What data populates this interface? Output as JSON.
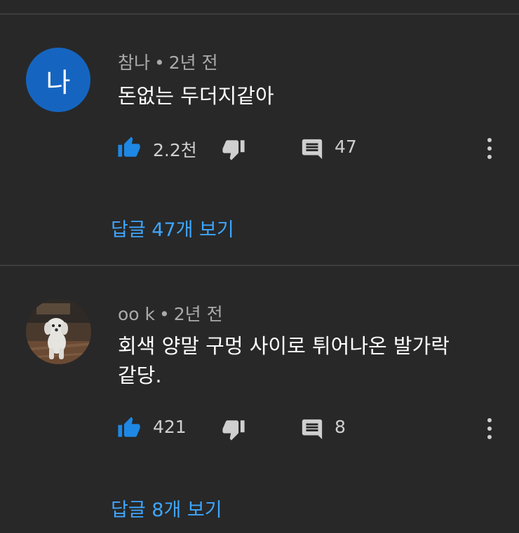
{
  "colors": {
    "background": "#282828",
    "accent": "#3ea6ff",
    "like_blue": "#1e88e5",
    "avatar_blue": "#1565c0"
  },
  "comments": [
    {
      "avatar_letter": "나",
      "author": "참나",
      "separator": "•",
      "time": "2년 전",
      "text": "돈없는 두더지같아",
      "likes": "2.2천",
      "replies": "47",
      "view_replies": "답글 47개 보기"
    },
    {
      "avatar_image": "dog-photo",
      "author": "oo k",
      "separator": "•",
      "time": "2년 전",
      "text": "회색 양말 구멍 사이로 튀어나온 발가락 같당.",
      "likes": "421",
      "replies": "8",
      "view_replies": "답글 8개 보기"
    }
  ],
  "icons": {
    "like": "thumbs-up-icon",
    "dislike": "thumbs-down-icon",
    "reply": "reply-comment-icon",
    "more": "more-vertical-icon"
  }
}
